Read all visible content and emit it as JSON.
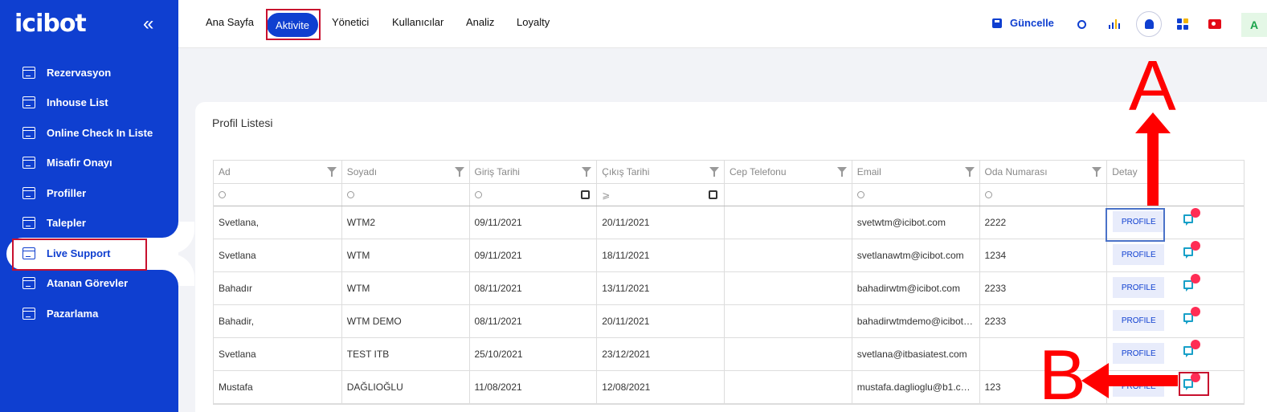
{
  "sidebar": {
    "logo": "icibot",
    "collapse_icon": "double-chevron-left-icon",
    "items": [
      {
        "label": "Rezervasyon"
      },
      {
        "label": "Inhouse List"
      },
      {
        "label": "Online Check In Liste"
      },
      {
        "label": "Misafir Onayı"
      },
      {
        "label": "Profiller"
      },
      {
        "label": "Talepler"
      },
      {
        "label": "Live Support"
      },
      {
        "label": "Atanan Görevler"
      },
      {
        "label": "Pazarlama"
      }
    ],
    "active_item": "Live Support"
  },
  "topbar": {
    "nav": [
      "Ana Sayfa",
      "Aktivite",
      "Yönetici",
      "Kullanıcılar",
      "Analiz",
      "Loyalty"
    ],
    "active_nav": "Aktivite",
    "update_label": "Güncelle",
    "avatar_letter": "A"
  },
  "card": {
    "title": "Profil Listesi",
    "columns": [
      "Ad",
      "Soyadı",
      "Giriş Tarihi",
      "Çıkış Tarihi",
      "Cep Telefonu",
      "Email",
      "Oda Numarası",
      "Detay"
    ],
    "rows": [
      [
        "Svetlana,",
        "WTM2",
        "09/11/2021",
        "20/11/2021",
        "",
        "svetwtm@icibot.com",
        "2222"
      ],
      [
        "Svetlana",
        "WTM",
        "09/11/2021",
        "18/11/2021",
        "",
        "svetlanawtm@icibot.com",
        "1234"
      ],
      [
        "Bahadır",
        "WTM",
        "08/11/2021",
        "13/11/2021",
        "",
        "bahadirwtm@icibot.com",
        "2233"
      ],
      [
        "Bahadir,",
        "WTM DEMO",
        "08/11/2021",
        "20/11/2021",
        "",
        "bahadirwtmdemo@icibot…",
        "2233"
      ],
      [
        "Svetlana",
        "TEST ITB",
        "25/10/2021",
        "23/12/2021",
        "",
        "svetlana@itbasiatest.com",
        ""
      ],
      [
        "Mustafa",
        "DAĞLIOĞLU",
        "11/08/2021",
        "12/08/2021",
        "",
        "mustafa.daglioglu@b1.c…",
        "123"
      ]
    ],
    "profile_label": "PROFILE"
  },
  "annotations": {
    "a": "A",
    "b": "B"
  },
  "colors": {
    "brand": "#0f3fd0",
    "annotation": "#ff0000",
    "badge": "#ff2d55"
  }
}
